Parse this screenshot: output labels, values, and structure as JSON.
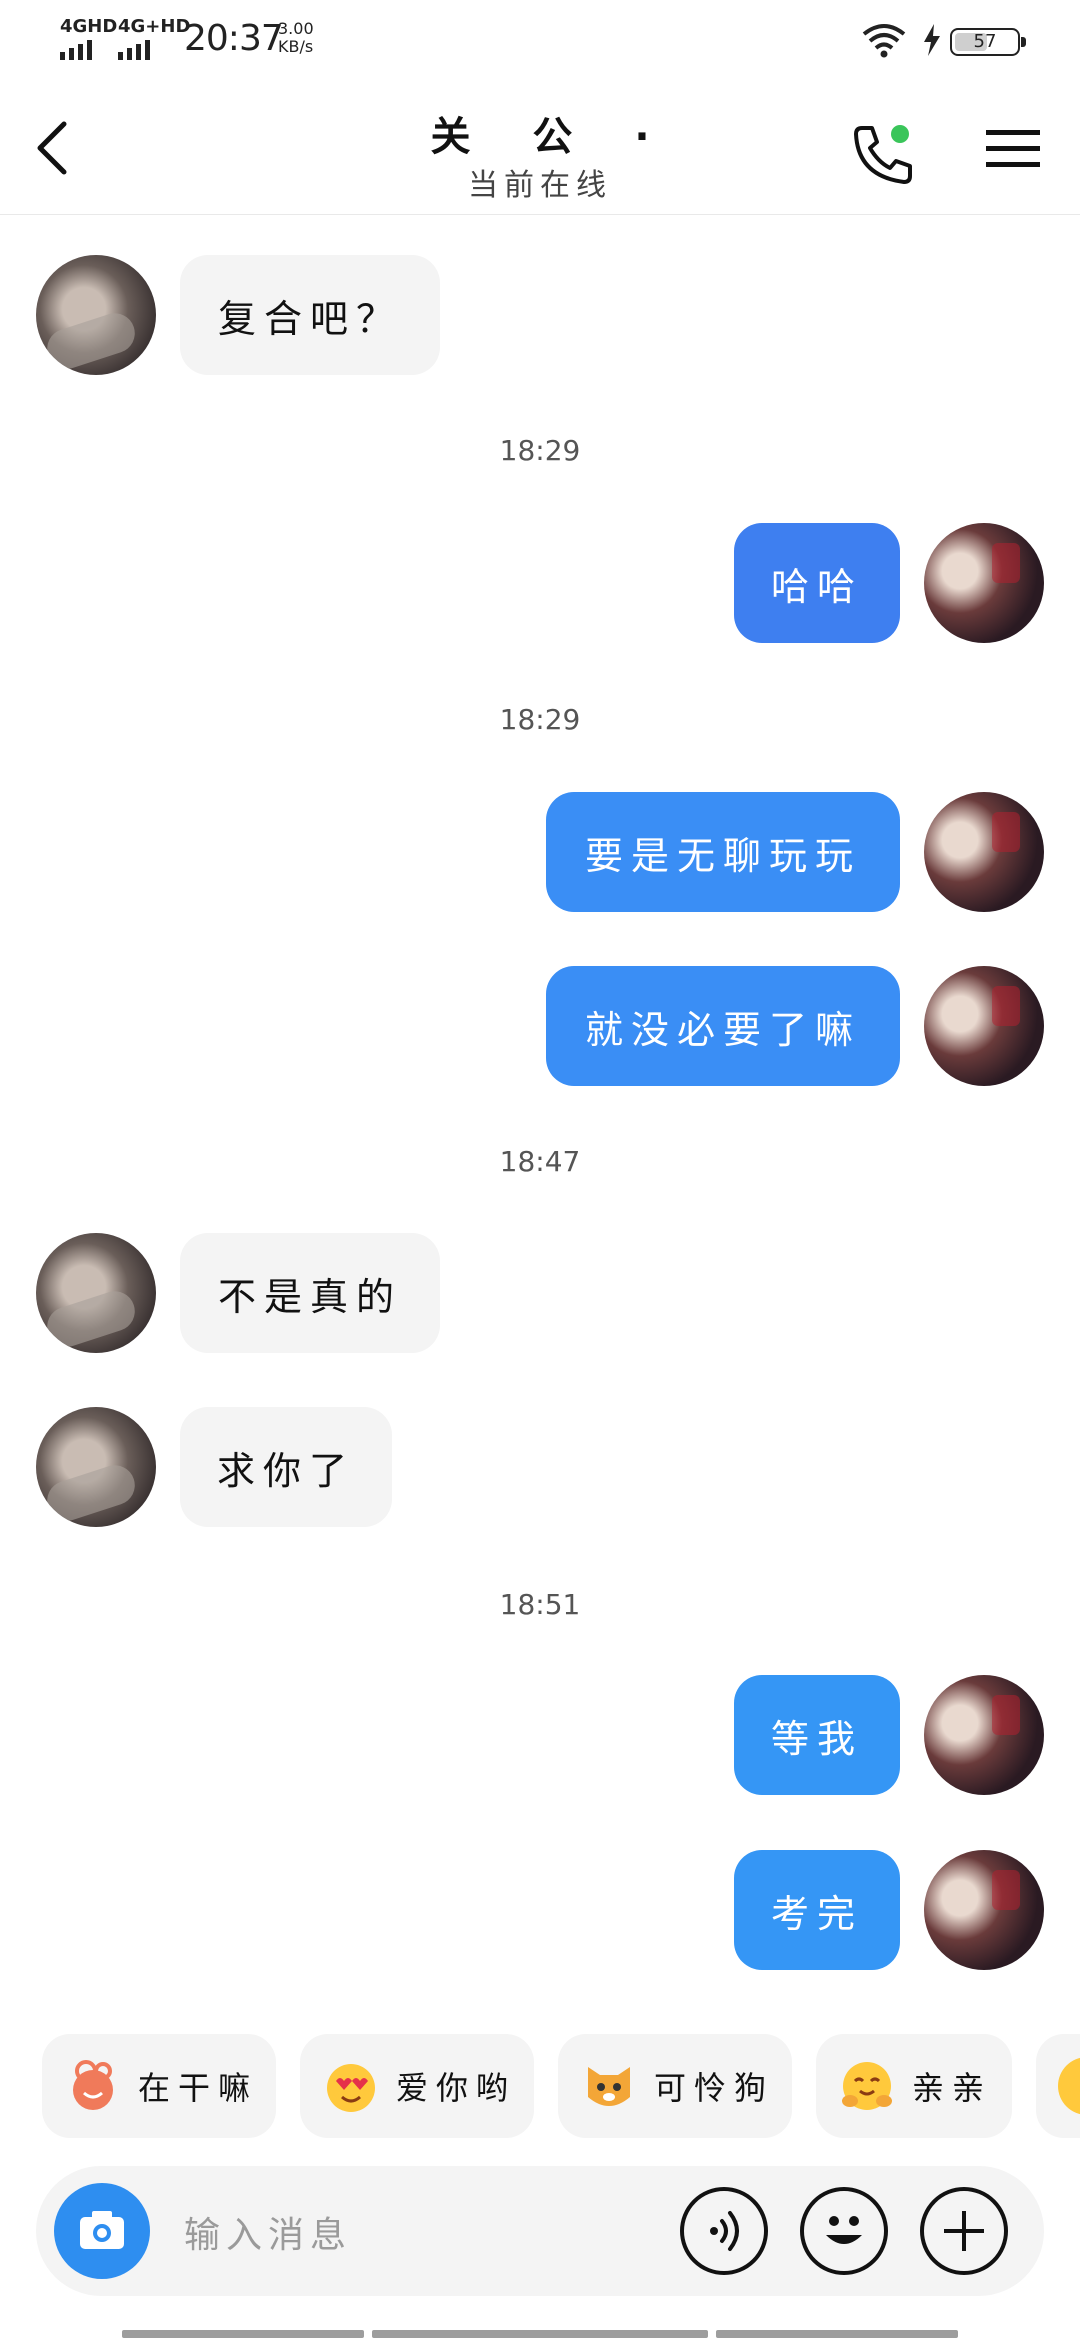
{
  "status_bar": {
    "network1": "4GHD",
    "network2": "4G+HD",
    "time": "20:37",
    "speed_value": "3.00",
    "speed_unit": "KB/s",
    "battery": "57"
  },
  "header": {
    "title": "关 公 ·",
    "subtitle": "当前在线",
    "online_dot_color": "#3ac55a"
  },
  "colors": {
    "out_bubble_dark": "#3e7ff0",
    "out_bubble": "#3a8ef5",
    "out_bubble_light": "#3596f5",
    "in_bubble": "#f4f4f4",
    "camera_button": "#2e8ef0"
  },
  "messages": [
    {
      "type": "msg",
      "side": "left",
      "text": "复合吧？"
    },
    {
      "type": "time",
      "text": "18:29"
    },
    {
      "type": "msg",
      "side": "right",
      "text": "哈哈"
    },
    {
      "type": "time",
      "text": "18:29"
    },
    {
      "type": "msg",
      "side": "right",
      "text": "要是无聊玩玩"
    },
    {
      "type": "msg",
      "side": "right",
      "text": "就没必要了嘛"
    },
    {
      "type": "time",
      "text": "18:47"
    },
    {
      "type": "msg",
      "side": "left",
      "text": "不是真的"
    },
    {
      "type": "msg",
      "side": "left",
      "text": "求你了"
    },
    {
      "type": "time",
      "text": "18:51"
    },
    {
      "type": "msg",
      "side": "right",
      "text": "等我"
    },
    {
      "type": "msg",
      "side": "right",
      "text": "考完"
    }
  ],
  "quick_replies": [
    {
      "icon": "flower-sticker-icon",
      "label": "在干嘛"
    },
    {
      "icon": "heart-eyes-emoji-icon",
      "label": "爱你哟"
    },
    {
      "icon": "pitiful-dog-emoji-icon",
      "label": "可怜狗"
    },
    {
      "icon": "hug-emoji-icon",
      "label": "亲亲"
    }
  ],
  "input": {
    "placeholder": "输入消息"
  },
  "icons": {
    "back": "back-arrow-icon",
    "phone": "phone-call-icon",
    "menu": "menu-icon",
    "camera": "camera-icon",
    "voice": "voice-icon",
    "emoji": "emoji-icon",
    "plus": "plus-icon"
  }
}
